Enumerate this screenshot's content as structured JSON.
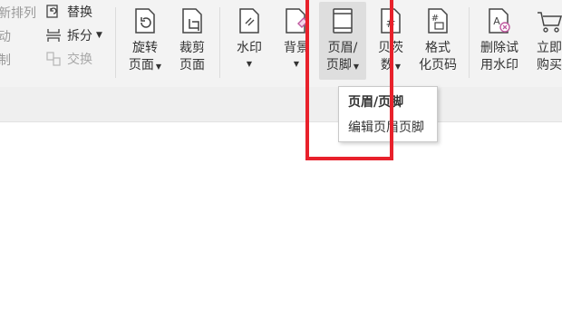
{
  "ribbon": {
    "left_clipped": [
      "新排列",
      "动",
      "制"
    ],
    "small_commands": [
      {
        "label": "替换",
        "icon": "replace-page-icon",
        "disabled": false,
        "dropdown": false
      },
      {
        "label": "拆分",
        "icon": "split-icon",
        "disabled": false,
        "dropdown": true
      },
      {
        "label": "交换",
        "icon": "swap-icon",
        "disabled": true,
        "dropdown": false
      }
    ],
    "buttons": [
      {
        "id": "rotate",
        "line1": "旋转",
        "line2": "页面",
        "icon": "rotate-page-icon",
        "dropdown": true
      },
      {
        "id": "crop",
        "line1": "裁剪",
        "line2": "页面",
        "icon": "crop-page-icon",
        "dropdown": false
      },
      {
        "id": "watermark",
        "line1": "水印",
        "line2": "",
        "icon": "watermark-icon",
        "dropdown": true
      },
      {
        "id": "background",
        "line1": "背景",
        "line2": "",
        "icon": "background-icon",
        "dropdown": true
      },
      {
        "id": "header-footer",
        "line1": "页眉/",
        "line2": "页脚",
        "icon": "header-footer-icon",
        "dropdown": true,
        "active": true
      },
      {
        "id": "bates",
        "line1": "贝茨",
        "line2": "数",
        "icon": "bates-number-icon",
        "dropdown": true
      },
      {
        "id": "format-page-number",
        "line1": "格式",
        "line2": "化页码",
        "icon": "format-page-number-icon",
        "dropdown": false
      },
      {
        "id": "remove-trial-watermark",
        "line1": "删除试",
        "line2": "用水印",
        "icon": "remove-watermark-icon",
        "dropdown": false
      },
      {
        "id": "buy-now",
        "line1": "立即",
        "line2": "购买",
        "icon": "cart-icon",
        "dropdown": false
      }
    ]
  },
  "tabbar": {
    "add_label": "+",
    "grid_icon": "grid-view-icon"
  },
  "tooltip": {
    "title": "页眉/页脚",
    "description": "编辑页眉页脚"
  },
  "colors": {
    "ribbon_bg": "#f3f3f3",
    "highlight": "#e8212b",
    "accent_pink": "#c05aa0"
  }
}
